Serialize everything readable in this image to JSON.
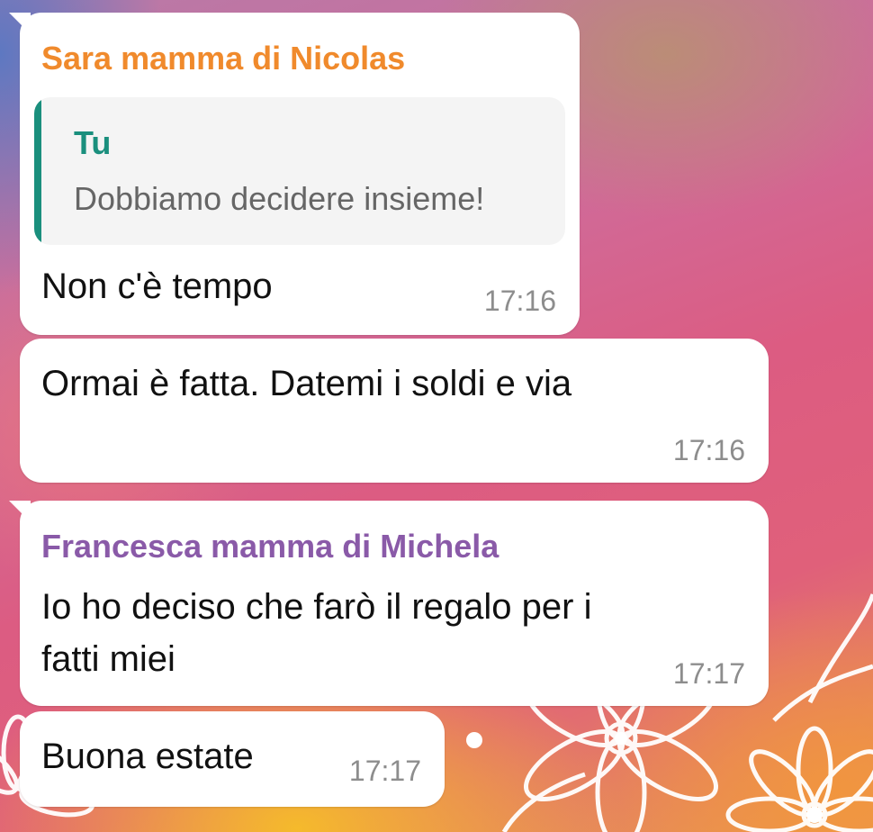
{
  "messages": [
    {
      "sender": "Sara mamma di Nicolas",
      "sender_color": "#f08a2c",
      "reply_to": {
        "name": "Tu",
        "text": "Dobbiamo decidere insieme!",
        "color": "#1a8f7d"
      },
      "text": "Non c'è tempo",
      "time": "17:16"
    },
    {
      "text": "Ormai è fatta. Datemi i soldi e via",
      "time": "17:16"
    },
    {
      "sender": "Francesca mamma di Michela",
      "sender_color": "#8a5aa8",
      "text_lines": [
        "Io ho deciso che farò il regalo per i",
        "fatti miei"
      ],
      "time": "17:17"
    },
    {
      "text": "Buona estate",
      "time": "17:17"
    }
  ],
  "background": {
    "style": "gradient with white flower doodles",
    "accent": "#dc5c82"
  }
}
